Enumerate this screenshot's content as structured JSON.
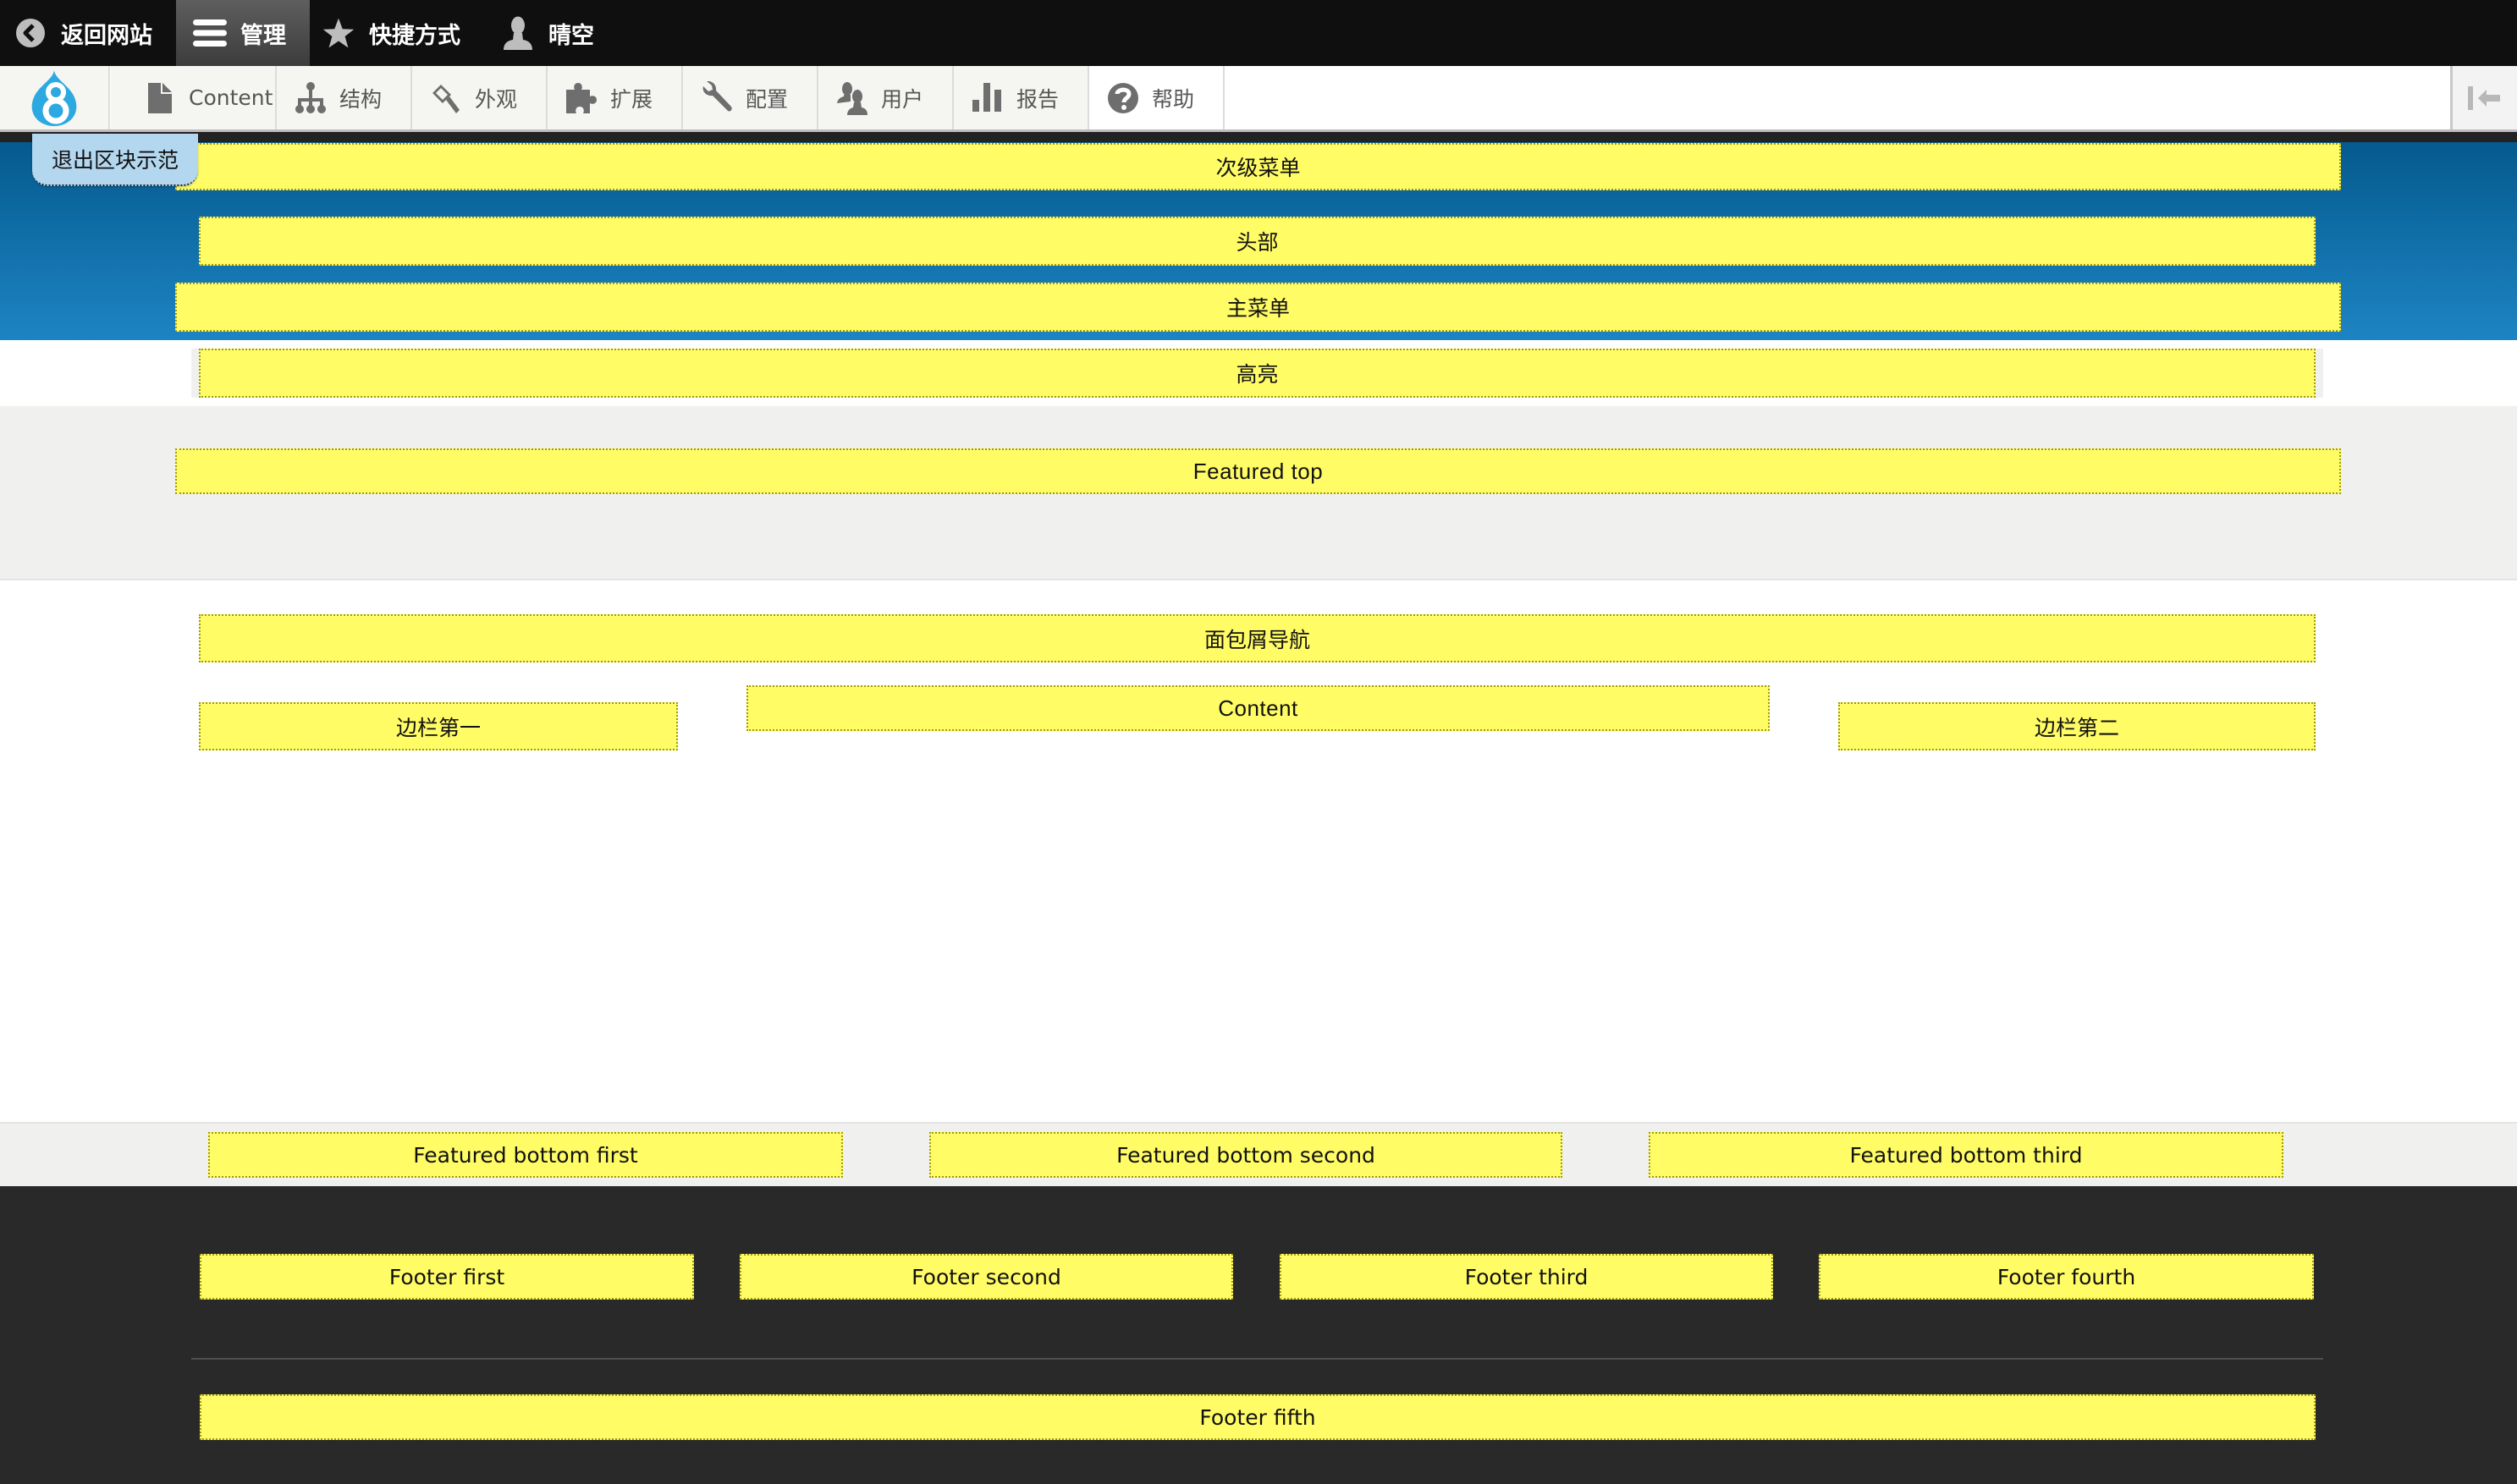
{
  "toolbar": {
    "back_to_site": "返回网站",
    "manage": "管理",
    "shortcuts": "快捷方式",
    "user": "晴空"
  },
  "tray": {
    "items": [
      {
        "label": "Content",
        "icon": "file-icon"
      },
      {
        "label": "结构",
        "icon": "sitemap-icon"
      },
      {
        "label": "外观",
        "icon": "paintbrush-icon"
      },
      {
        "label": "扩展",
        "icon": "puzzle-icon"
      },
      {
        "label": "配置",
        "icon": "wrench-icon"
      },
      {
        "label": "用户",
        "icon": "people-icon"
      },
      {
        "label": "报告",
        "icon": "bar-chart-icon"
      },
      {
        "label": "帮助",
        "icon": "help-icon",
        "active": true
      }
    ]
  },
  "exit_demo": "退出区块示范",
  "regions": {
    "secondary_menu": "次级菜单",
    "header": "头部",
    "primary_menu": "主菜单",
    "highlighted": "高亮",
    "featured_top": "Featured top",
    "breadcrumb": "面包屑导航",
    "sidebar_first": "边栏第一",
    "content": "Content",
    "sidebar_second": "边栏第二",
    "featured_bottom_first": "Featured bottom first",
    "featured_bottom_second": "Featured bottom second",
    "featured_bottom_third": "Featured bottom third",
    "footer_first": "Footer first",
    "footer_second": "Footer second",
    "footer_third": "Footer third",
    "footer_fourth": "Footer fourth",
    "footer_fifth": "Footer fifth"
  },
  "colors": {
    "region_fill": "#fffc66",
    "header_top": "#055a8e",
    "header_bottom": "#1d84c3",
    "footer_bg": "#292929",
    "logo_blue": "#2ba9e0"
  }
}
